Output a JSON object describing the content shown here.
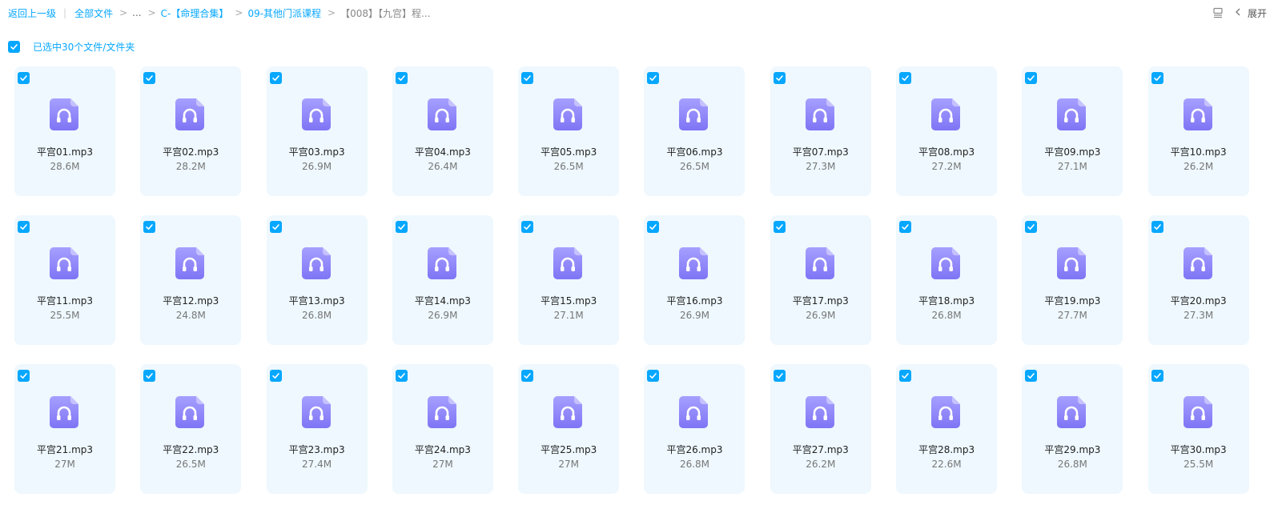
{
  "breadcrumb": {
    "back": "返回上一级",
    "items": [
      {
        "label": "全部文件"
      },
      {
        "label": "..."
      },
      {
        "label": "C-【命理合集】"
      },
      {
        "label": "09-其他门派课程"
      },
      {
        "label": "【008】【九宫】程..."
      }
    ]
  },
  "toolbar": {
    "expand_label": "展开",
    "layout_icon": "list-layout-icon",
    "chevron_icon": "chevron-left-icon"
  },
  "selection": {
    "label": "已选中30个文件/文件夹"
  },
  "colors": {
    "accent": "#06a7ff",
    "card_bg": "#eef8fe",
    "icon_top": "#a7a0ff",
    "icon_bottom": "#7e74f5"
  },
  "files": [
    {
      "name": "平宫01.mp3",
      "size": "28.6M"
    },
    {
      "name": "平宫02.mp3",
      "size": "28.2M"
    },
    {
      "name": "平宫03.mp3",
      "size": "26.9M"
    },
    {
      "name": "平宫04.mp3",
      "size": "26.4M"
    },
    {
      "name": "平宫05.mp3",
      "size": "26.5M"
    },
    {
      "name": "平宫06.mp3",
      "size": "26.5M"
    },
    {
      "name": "平宫07.mp3",
      "size": "27.3M"
    },
    {
      "name": "平宫08.mp3",
      "size": "27.2M"
    },
    {
      "name": "平宫09.mp3",
      "size": "27.1M"
    },
    {
      "name": "平宫10.mp3",
      "size": "26.2M"
    },
    {
      "name": "平宫11.mp3",
      "size": "25.5M"
    },
    {
      "name": "平宫12.mp3",
      "size": "24.8M"
    },
    {
      "name": "平宫13.mp3",
      "size": "26.8M"
    },
    {
      "name": "平宫14.mp3",
      "size": "26.9M"
    },
    {
      "name": "平宫15.mp3",
      "size": "27.1M"
    },
    {
      "name": "平宫16.mp3",
      "size": "26.9M"
    },
    {
      "name": "平宫17.mp3",
      "size": "26.9M"
    },
    {
      "name": "平宫18.mp3",
      "size": "26.8M"
    },
    {
      "name": "平宫19.mp3",
      "size": "27.7M"
    },
    {
      "name": "平宫20.mp3",
      "size": "27.3M"
    },
    {
      "name": "平宫21.mp3",
      "size": "27M"
    },
    {
      "name": "平宫22.mp3",
      "size": "26.5M"
    },
    {
      "name": "平宫23.mp3",
      "size": "27.4M"
    },
    {
      "name": "平宫24.mp3",
      "size": "27M"
    },
    {
      "name": "平宫25.mp3",
      "size": "27M"
    },
    {
      "name": "平宫26.mp3",
      "size": "26.8M"
    },
    {
      "name": "平宫27.mp3",
      "size": "26.2M"
    },
    {
      "name": "平宫28.mp3",
      "size": "22.6M"
    },
    {
      "name": "平宫29.mp3",
      "size": "26.8M"
    },
    {
      "name": "平宫30.mp3",
      "size": "25.5M"
    }
  ]
}
